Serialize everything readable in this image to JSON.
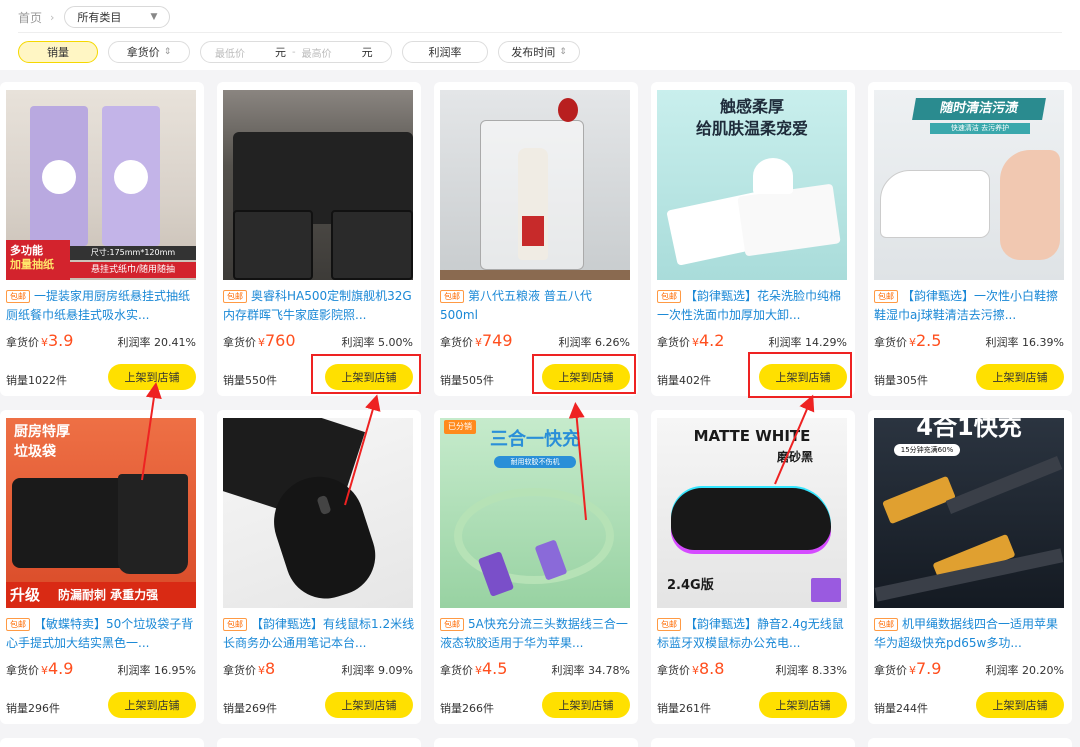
{
  "breadcrumb": {
    "home": "首页",
    "category": "所有类目"
  },
  "filters": {
    "sales": "销量",
    "price": "拿货价",
    "min_price": "最低价",
    "max_price": "最高价",
    "unit": "元",
    "dash": "-",
    "margin": "利润率",
    "publish_time": "发布时间"
  },
  "labels": {
    "price": "拿货价",
    "currency": "¥",
    "shelf_button": "上架到店铺"
  },
  "products": [
    {
      "badge": "包邮",
      "title": "一提装家用厨房纸悬挂式抽纸厕纸餐巾纸悬挂式吸水实...",
      "price": "3.9",
      "margin": "利润率 20.41%",
      "sales": "销量1022件"
    },
    {
      "badge": "包邮",
      "title": "奥睿科HA500定制旗舰机32G内存群晖飞牛家庭影院照...",
      "price": "760",
      "margin": "利润率 5.00%",
      "sales": "销量550件"
    },
    {
      "badge": "包邮",
      "title": "第八代五粮液 普五八代 500ml",
      "price": "749",
      "margin": "利润率 6.26%",
      "sales": "销量505件"
    },
    {
      "badge": "包邮",
      "title": "【韵律甄选】花朵洗脸巾纯棉一次性洗面巾加厚加大卸...",
      "price": "4.2",
      "margin": "利润率 14.29%",
      "sales": "销量402件"
    },
    {
      "badge": "包邮",
      "title": "【韵律甄选】一次性小白鞋擦鞋湿巾aj球鞋清洁去污擦...",
      "price": "2.5",
      "margin": "利润率 16.39%",
      "sales": "销量305件"
    },
    {
      "badge": "包邮",
      "title": "【敏蝶特卖】50个垃圾袋子背心手提式加大结实黑色一...",
      "price": "4.9",
      "margin": "利润率 16.95%",
      "sales": "销量296件"
    },
    {
      "badge": "包邮",
      "title": "【韵律甄选】有线鼠标1.2米线长商务办公通用笔记本台...",
      "price": "8",
      "margin": "利润率 9.09%",
      "sales": "销量269件"
    },
    {
      "badge": "包邮",
      "title": "5A快充分流三头数据线三合一液态软胶适用于华为苹果...",
      "price": "4.5",
      "margin": "利润率 34.78%",
      "sales": "销量266件"
    },
    {
      "badge": "包邮",
      "title": "【韵律甄选】静音2.4g无线鼠标蓝牙双模鼠标办公充电...",
      "price": "8.8",
      "margin": "利润率 8.33%",
      "sales": "销量261件"
    },
    {
      "badge": "包邮",
      "title": "机甲绳数据线四合一适用苹果华为超级快充pd65w多功...",
      "price": "7.9",
      "margin": "利润率 20.20%",
      "sales": "销量244件"
    }
  ],
  "image_text": {
    "p1_a": "多功能",
    "p1_b": "加量抽纸",
    "p1_c": "尺寸:175mm*120mm",
    "p1_d": "悬挂式纸巾/随用随抽",
    "p4_a": "触感柔厚",
    "p4_b": "给肌肤温柔宠爱",
    "p5_a": "随时清洁污渍",
    "p5_b": "快速清洁 去污养护",
    "p6_a": "厨房特厚",
    "p6_b": "垃圾袋",
    "p6_c": "升级",
    "p6_d": "防漏耐刺 承重力强",
    "p8_a": "已分销",
    "p8_b": "三合一快充",
    "p8_c": "耐用软胶不伤机",
    "p9_a": "MATTE WHITE",
    "p9_b": "磨砂黑",
    "p9_c": "2.4G版",
    "p10_a": "4合1快充",
    "p10_b": "15分钟充满60%"
  }
}
